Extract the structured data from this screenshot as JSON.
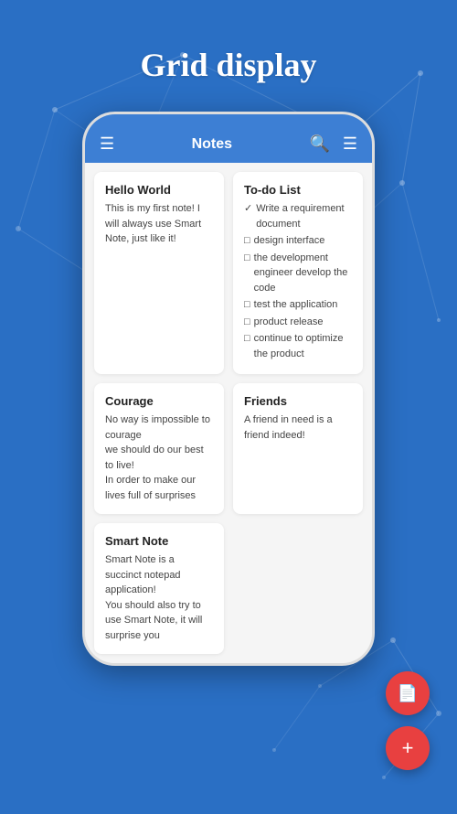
{
  "page": {
    "title": "Grid display",
    "background_color": "#2a6fc4"
  },
  "app": {
    "header": {
      "title": "Notes",
      "hamburger_label": "☰",
      "search_label": "🔍",
      "filter_label": "☰"
    }
  },
  "notes": [
    {
      "id": "hello-world",
      "title": "Hello World",
      "body": "This is my first note! I will always use Smart Note, just like it!",
      "type": "text"
    },
    {
      "id": "to-do-list",
      "title": "To-do List",
      "type": "todo",
      "items": [
        {
          "checked": true,
          "text": "Write a requirement document"
        },
        {
          "checked": false,
          "text": "design interface"
        },
        {
          "checked": false,
          "text": "the development engineer develop the code"
        },
        {
          "checked": false,
          "text": "test the application"
        },
        {
          "checked": false,
          "text": "product release"
        },
        {
          "checked": false,
          "text": "continue to optimize the product"
        }
      ]
    },
    {
      "id": "courage",
      "title": "Courage",
      "body": "No way is impossible to courage\nwe should do our best to live!\nIn order to make our lives full of surprises",
      "type": "text"
    },
    {
      "id": "friends",
      "title": "Friends",
      "body": "A friend in need is a friend indeed!",
      "type": "text"
    },
    {
      "id": "smart-note",
      "title": "Smart Note",
      "body": "Smart Note is a succinct notepad application!\nYou should also try to use Smart Note, it will surprise you",
      "type": "text"
    }
  ],
  "fabs": [
    {
      "id": "fab-doc",
      "icon": "📄",
      "label": "new-document"
    },
    {
      "id": "fab-add",
      "icon": "+",
      "label": "add-note"
    }
  ]
}
